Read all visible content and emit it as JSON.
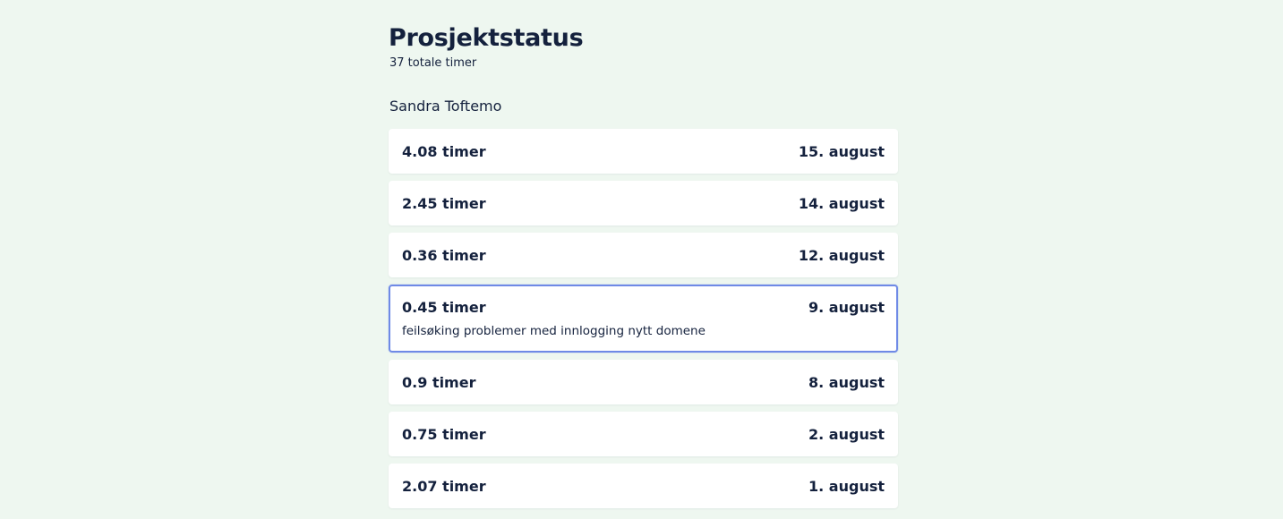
{
  "page": {
    "title": "Prosjektstatus",
    "total_hours_label": "37 totale timer"
  },
  "person": {
    "name": "Sandra Toftemo"
  },
  "entries": [
    {
      "hours": "4.08 timer",
      "date": "15. august",
      "description": "",
      "selected": false
    },
    {
      "hours": "2.45 timer",
      "date": "14. august",
      "description": "",
      "selected": false
    },
    {
      "hours": "0.36 timer",
      "date": "12. august",
      "description": "",
      "selected": false
    },
    {
      "hours": "0.45 timer",
      "date": "9. august",
      "description": "feilsøking problemer med innlogging nytt domene",
      "selected": true
    },
    {
      "hours": "0.9 timer",
      "date": "8. august",
      "description": "",
      "selected": false
    },
    {
      "hours": "0.75 timer",
      "date": "2. august",
      "description": "",
      "selected": false
    },
    {
      "hours": "2.07 timer",
      "date": "1. august",
      "description": "",
      "selected": false
    }
  ],
  "colors": {
    "background": "#eef7f0",
    "card": "#ffffff",
    "text": "#14213d",
    "selected_border": "#6f8ae6"
  }
}
